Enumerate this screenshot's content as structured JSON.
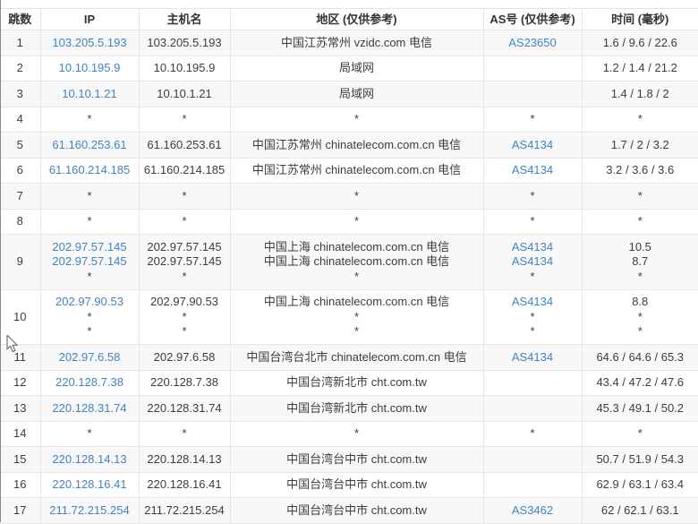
{
  "table": {
    "columns": [
      {
        "key": "hop",
        "label": "跳数"
      },
      {
        "key": "ip",
        "label": "IP"
      },
      {
        "key": "host",
        "label": "主机名"
      },
      {
        "key": "region",
        "label": "地区 (仅供参考)"
      },
      {
        "key": "asn",
        "label": "AS号 (仅供参考)"
      },
      {
        "key": "time",
        "label": "时间 (毫秒)"
      }
    ],
    "link_color": "#4183c4",
    "stripe_color": "#f8f8f8",
    "rows": [
      {
        "hop": "1",
        "ip": [
          "103.205.5.193"
        ],
        "host": [
          "103.205.5.193"
        ],
        "region": [
          "中国江苏常州 vzidc.com 电信"
        ],
        "asn": [
          "AS23650"
        ],
        "time": [
          "1.6 / 9.6 / 22.6"
        ]
      },
      {
        "hop": "2",
        "ip": [
          "10.10.195.9"
        ],
        "host": [
          "10.10.195.9"
        ],
        "region": [
          "局域网"
        ],
        "asn": [
          ""
        ],
        "time": [
          "1.2 / 1.4 / 21.2"
        ]
      },
      {
        "hop": "3",
        "ip": [
          "10.10.1.21"
        ],
        "host": [
          "10.10.1.21"
        ],
        "region": [
          "局域网"
        ],
        "asn": [
          ""
        ],
        "time": [
          "1.4 / 1.8 / 2"
        ]
      },
      {
        "hop": "4",
        "ip": [
          "*"
        ],
        "host": [
          "*"
        ],
        "region": [
          "*"
        ],
        "asn": [
          "*"
        ],
        "time": [
          "*"
        ]
      },
      {
        "hop": "5",
        "ip": [
          "61.160.253.61"
        ],
        "host": [
          "61.160.253.61"
        ],
        "region": [
          "中国江苏常州 chinatelecom.com.cn 电信"
        ],
        "asn": [
          "AS4134"
        ],
        "time": [
          "1.7 / 2 / 3.2"
        ]
      },
      {
        "hop": "6",
        "ip": [
          "61.160.214.185"
        ],
        "host": [
          "61.160.214.185"
        ],
        "region": [
          "中国江苏常州 chinatelecom.com.cn 电信"
        ],
        "asn": [
          "AS4134"
        ],
        "time": [
          "3.2 / 3.6 / 3.6"
        ]
      },
      {
        "hop": "7",
        "ip": [
          "*"
        ],
        "host": [
          "*"
        ],
        "region": [
          "*"
        ],
        "asn": [
          "*"
        ],
        "time": [
          "*"
        ]
      },
      {
        "hop": "8",
        "ip": [
          "*"
        ],
        "host": [
          "*"
        ],
        "region": [
          "*"
        ],
        "asn": [
          "*"
        ],
        "time": [
          "*"
        ]
      },
      {
        "hop": "9",
        "ip": [
          "202.97.57.145",
          "202.97.57.145",
          "*"
        ],
        "host": [
          "202.97.57.145",
          "202.97.57.145",
          "*"
        ],
        "region": [
          "中国上海 chinatelecom.com.cn 电信",
          "中国上海 chinatelecom.com.cn 电信",
          "*"
        ],
        "asn": [
          "AS4134",
          "AS4134",
          "*"
        ],
        "time": [
          "10.5",
          "8.7",
          "*"
        ]
      },
      {
        "hop": "10",
        "ip": [
          "202.97.90.53",
          "*",
          "*"
        ],
        "host": [
          "202.97.90.53",
          "*",
          "*"
        ],
        "region": [
          "中国上海 chinatelecom.com.cn 电信",
          "*",
          "*"
        ],
        "asn": [
          "AS4134",
          "*",
          "*"
        ],
        "time": [
          "8.8",
          "*",
          "*"
        ]
      },
      {
        "hop": "11",
        "ip": [
          "202.97.6.58"
        ],
        "host": [
          "202.97.6.58"
        ],
        "region": [
          "中国台湾台北市 chinatelecom.com.cn 电信"
        ],
        "asn": [
          "AS4134"
        ],
        "time": [
          "64.6 / 64.6 / 65.3"
        ]
      },
      {
        "hop": "12",
        "ip": [
          "220.128.7.38"
        ],
        "host": [
          "220.128.7.38"
        ],
        "region": [
          "中国台湾新北市 cht.com.tw"
        ],
        "asn": [
          ""
        ],
        "time": [
          "43.4 / 47.2 / 47.6"
        ]
      },
      {
        "hop": "13",
        "ip": [
          "220.128.31.74"
        ],
        "host": [
          "220.128.31.74"
        ],
        "region": [
          "中国台湾新北市 cht.com.tw"
        ],
        "asn": [
          ""
        ],
        "time": [
          "45.3 / 49.1 / 50.2"
        ]
      },
      {
        "hop": "14",
        "ip": [
          "*"
        ],
        "host": [
          "*"
        ],
        "region": [
          "*"
        ],
        "asn": [
          "*"
        ],
        "time": [
          "*"
        ]
      },
      {
        "hop": "15",
        "ip": [
          "220.128.14.13"
        ],
        "host": [
          "220.128.14.13"
        ],
        "region": [
          "中国台湾台中市 cht.com.tw"
        ],
        "asn": [
          ""
        ],
        "time": [
          "50.7 / 51.9 / 54.3"
        ]
      },
      {
        "hop": "16",
        "ip": [
          "220.128.16.41"
        ],
        "host": [
          "220.128.16.41"
        ],
        "region": [
          "中国台湾台中市 cht.com.tw"
        ],
        "asn": [
          ""
        ],
        "time": [
          "62.9 / 63.1 / 63.4"
        ]
      },
      {
        "hop": "17",
        "ip": [
          "211.72.215.254"
        ],
        "host": [
          "211.72.215.254"
        ],
        "region": [
          "中国台湾台中市 cht.com.tw"
        ],
        "asn": [
          "AS3462"
        ],
        "time": [
          "62 / 62.1 / 63.1"
        ]
      }
    ]
  }
}
